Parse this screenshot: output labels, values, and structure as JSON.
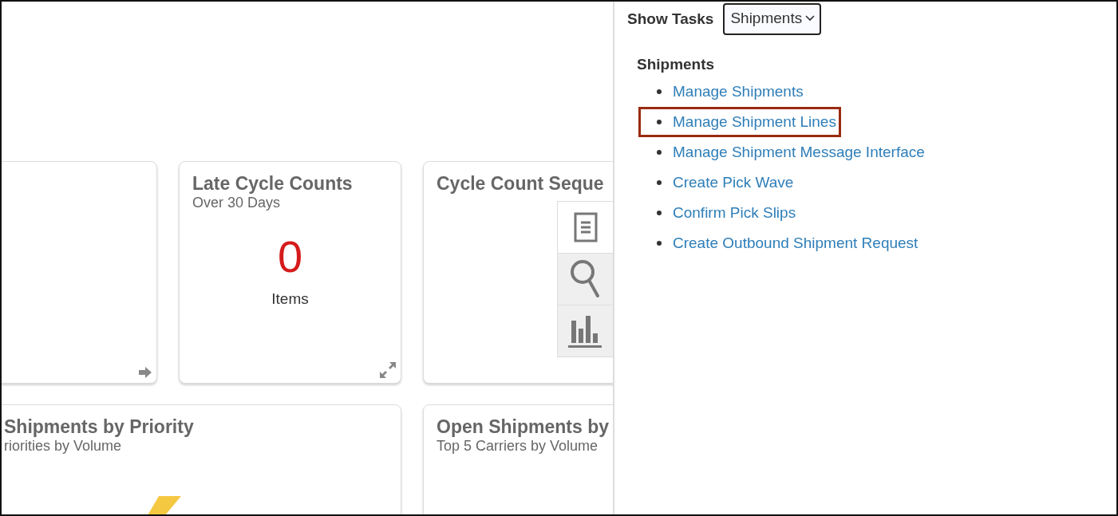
{
  "dashboard": {
    "row_1": [
      {
        "kind": "empty"
      },
      {
        "kind": "count",
        "title": "Late Cycle Counts",
        "subtitle": "Over 30 Days",
        "value": "0",
        "unit": "Items"
      },
      {
        "kind": "title",
        "title": "Cycle Count Seque"
      }
    ],
    "row_2": [
      {
        "kind": "chart",
        "title": "Shipments by Priority",
        "subtitle": "riorities by Volume"
      },
      {
        "kind": "title",
        "title": "Open Shipments by",
        "subtitle": "Top 5 Carriers by Volume"
      }
    ]
  },
  "side_toolbar": [
    {
      "selected": true
    },
    {
      "selected": false
    },
    {
      "selected": false
    }
  ],
  "tasks_panel": {
    "label": "Show Tasks",
    "dropdown": "Shipments",
    "heading": "Shipments",
    "links": [
      {
        "label": "Manage Shipments",
        "highlighted": false
      },
      {
        "label": "Manage Shipment Lines",
        "highlighted": true
      },
      {
        "label": "Manage Shipment Message Interface",
        "highlighted": false
      },
      {
        "label": "Create Pick Wave",
        "highlighted": false
      },
      {
        "label": "Confirm Pick Slips",
        "highlighted": false
      },
      {
        "label": "Create Outbound Shipment Request",
        "highlighted": false
      }
    ]
  }
}
